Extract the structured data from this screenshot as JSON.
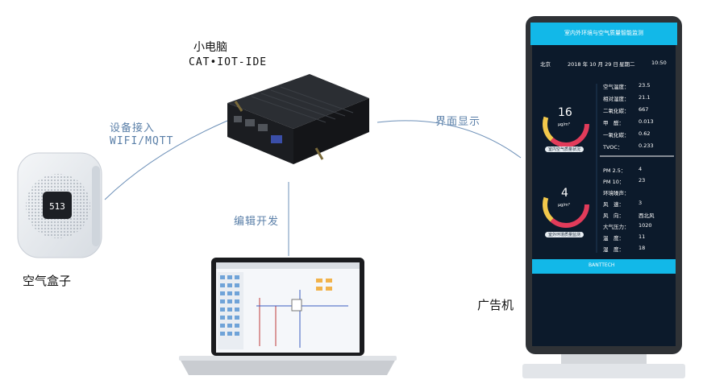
{
  "nodes": {
    "mini_pc": {
      "title": "小电脑",
      "subtitle": "CAT•IOT-IDE"
    },
    "air_box": {
      "title": "空气盒子",
      "display_value": "513"
    },
    "kiosk": {
      "title": "广告机"
    }
  },
  "edges": {
    "air_to_pc": {
      "line1": "设备接入",
      "line2": "WIFI/MQTT"
    },
    "pc_to_kiosk": {
      "label": "界面显示"
    },
    "laptop_to_pc": {
      "label": "编辑开发"
    }
  },
  "kiosk_screen": {
    "header": "室内外环境与空气质量智能监测",
    "city": "北京",
    "date": "2018 年 10 月 29 日",
    "weekday": "星期二",
    "time": "10:50",
    "gauge1_value": "16",
    "gauge1_unit": "µg/m³",
    "gauge1_button": "室内空气质量状况",
    "gauge2_value": "4",
    "gauge2_unit": "µg/m³",
    "gauge2_button": "室外环境质量监测",
    "readings_top": [
      {
        "label": "空气温度：",
        "value": "23.5"
      },
      {
        "label": "相对湿度：",
        "value": "21.1"
      },
      {
        "label": "二氧化碳：",
        "value": "667"
      },
      {
        "label": "甲　醛：",
        "value": "0.013"
      },
      {
        "label": "一氧化碳：",
        "value": "0.62"
      },
      {
        "label": "TVOC：",
        "value": "0.233"
      }
    ],
    "readings_bottom": [
      {
        "label": "PM 2.5：",
        "value": "4"
      },
      {
        "label": "PM 10：",
        "value": "23"
      },
      {
        "label": "环境噪声：",
        "value": ""
      },
      {
        "label": "风　速：",
        "value": "3"
      },
      {
        "label": "风　向：",
        "value": "西北风"
      },
      {
        "label": "大气压力：",
        "value": "1020"
      },
      {
        "label": "温　度：",
        "value": "11"
      },
      {
        "label": "湿　度：",
        "value": "18"
      }
    ],
    "footer_brand": "BANTTECH"
  },
  "colors": {
    "edge_line": "#6d90b8",
    "edge_text": "#5a7fa8",
    "kiosk_header": "#12b8e8",
    "kiosk_bg": "#0c1a2b"
  }
}
